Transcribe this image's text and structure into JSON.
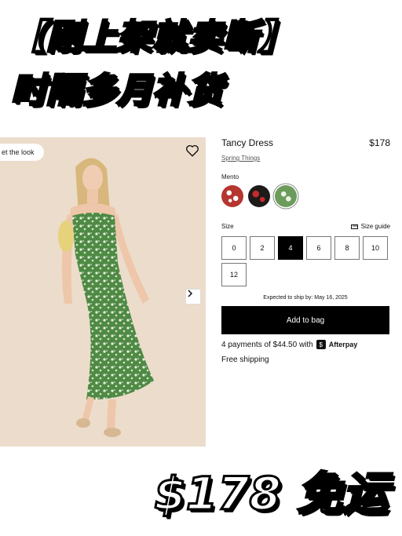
{
  "overlay": {
    "headline_1": "【刚上架就卖断】",
    "headline_2": "时隔多月补货",
    "bottom_price": "$178 免运"
  },
  "photo": {
    "get_the_look": "et the look",
    "heart_icon": "heart-icon",
    "next_icon": "chevron-right-icon"
  },
  "product": {
    "name": "Tancy Dress",
    "price": "$178",
    "collection": "Spring Things",
    "color_label": "Mento",
    "swatches": [
      {
        "name": "red-dot",
        "color": "#b5352f"
      },
      {
        "name": "dark-red",
        "color": "#7a1520"
      },
      {
        "name": "mento-green",
        "color": "#6c9c5b"
      }
    ],
    "size_label": "Size",
    "size_guide": "Size guide",
    "sizes": [
      "0",
      "2",
      "4",
      "6",
      "8",
      "10",
      "12"
    ],
    "selected_size": "4",
    "ship_note": "Expected to ship by: May 16, 2025",
    "add_to_bag": "Add to bag",
    "afterpay_text": "4 payments of $44.50 with",
    "afterpay_brand": "Afterpay",
    "free_shipping": "Free shipping"
  }
}
